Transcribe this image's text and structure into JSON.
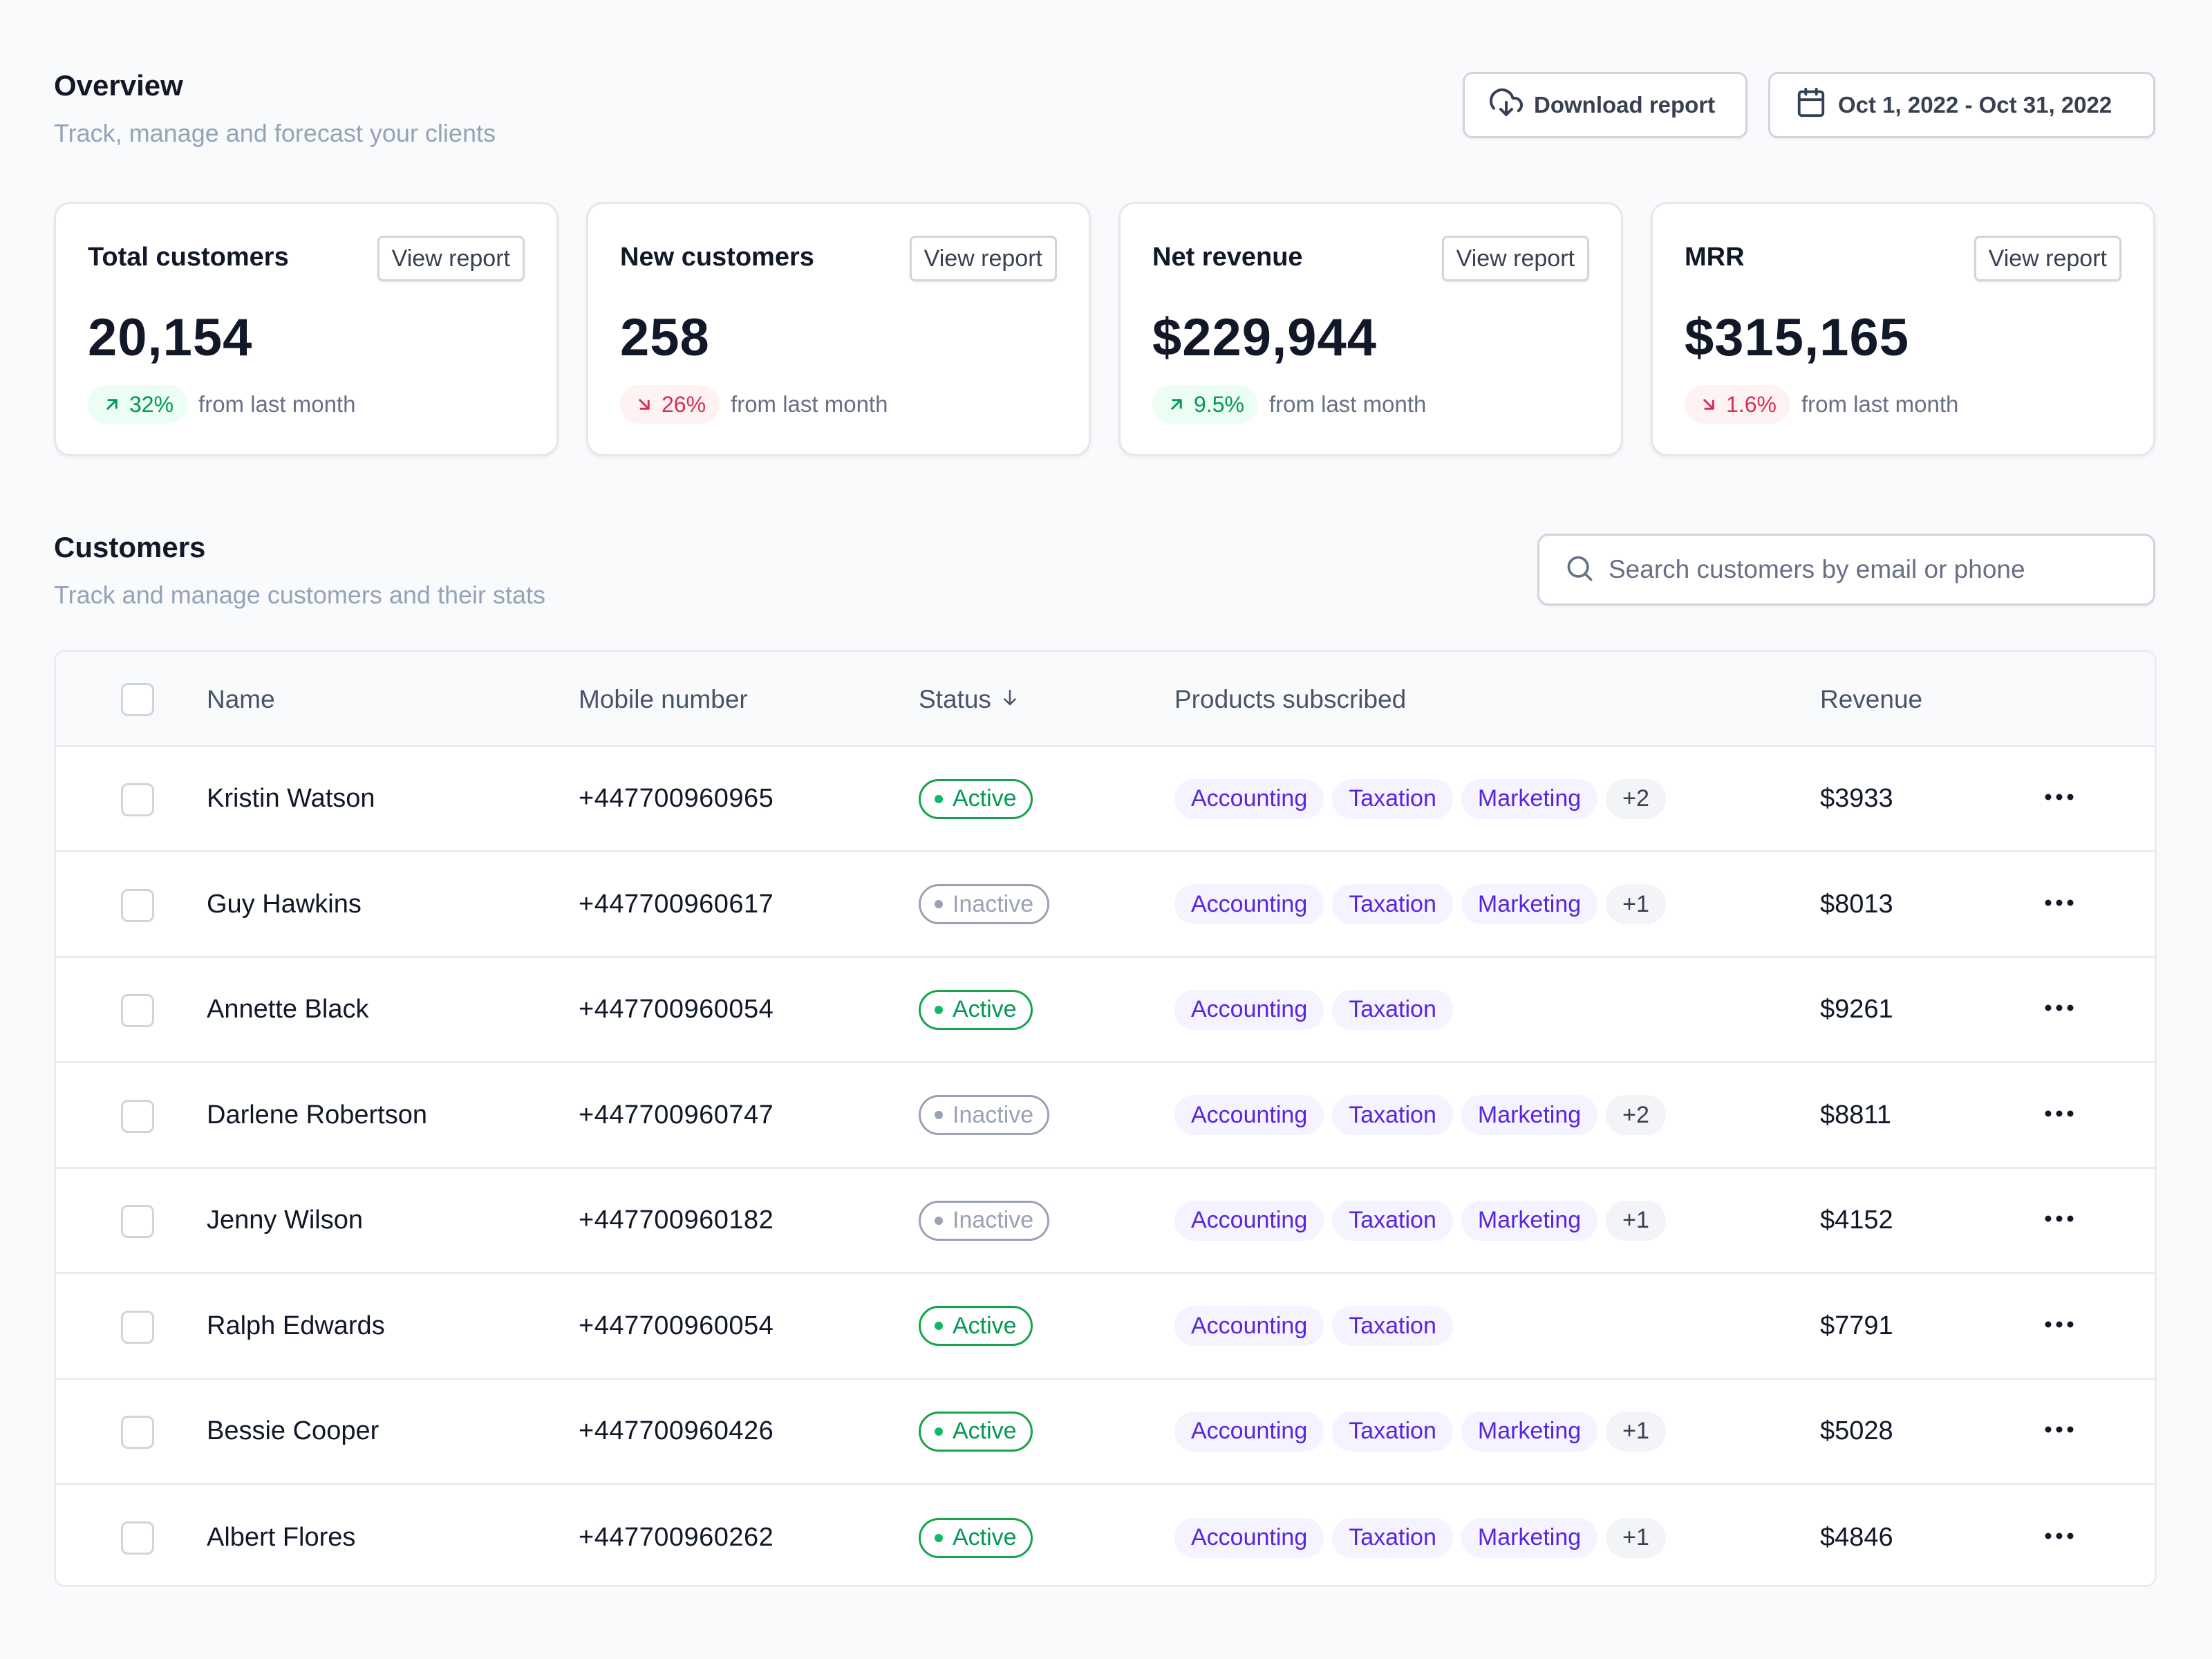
{
  "overview": {
    "title": "Overview",
    "subtitle": "Track, manage and forecast your clients",
    "download_label": "Download report",
    "date_range": "Oct 1, 2022 - Oct 31, 2022"
  },
  "colors": {
    "background": "#f8fafc",
    "positive": "#039855",
    "negative": "#d92d54",
    "chip_text": "#5925dc",
    "chip_bg": "#f4f3ff",
    "active": "#12b76a",
    "inactive": "#98a2b3"
  },
  "stats": [
    {
      "title": "Total customers",
      "button": "View report",
      "value": "20,154",
      "trend": "up",
      "trend_icon": "arrow-up-right-icon",
      "change": "32%",
      "change_label": "from last month"
    },
    {
      "title": "New customers",
      "button": "View report",
      "value": "258",
      "trend": "down",
      "trend_icon": "arrow-down-right-icon",
      "change": "26%",
      "change_label": "from last month"
    },
    {
      "title": "Net revenue",
      "button": "View report",
      "value": "$229,944",
      "trend": "up",
      "trend_icon": "arrow-up-right-icon",
      "change": "9.5%",
      "change_label": "from last month"
    },
    {
      "title": "MRR",
      "button": "View report",
      "value": "$315,165",
      "trend": "down",
      "trend_icon": "arrow-down-right-icon",
      "change": "1.6%",
      "change_label": "from last month"
    }
  ],
  "customers": {
    "title": "Customers",
    "subtitle": "Track and manage customers and their stats",
    "search": {
      "placeholder": "Search customers by email or phone",
      "value": ""
    },
    "columns": {
      "name": "Name",
      "mobile": "Mobile number",
      "status": "Status",
      "products": "Products subscribed",
      "revenue": "Revenue"
    },
    "rows": [
      {
        "name": "Kristin Watson",
        "mobile": "+447700960965",
        "status": "Active",
        "products": [
          "Accounting",
          "Taxation",
          "Marketing"
        ],
        "more": "+2",
        "revenue": "$3933"
      },
      {
        "name": "Guy Hawkins",
        "mobile": "+447700960617",
        "status": "Inactive",
        "products": [
          "Accounting",
          "Taxation",
          "Marketing"
        ],
        "more": "+1",
        "revenue": "$8013"
      },
      {
        "name": "Annette Black",
        "mobile": "+447700960054",
        "status": "Active",
        "products": [
          "Accounting",
          "Taxation"
        ],
        "more": "",
        "revenue": "$9261"
      },
      {
        "name": "Darlene Robertson",
        "mobile": "+447700960747",
        "status": "Inactive",
        "products": [
          "Accounting",
          "Taxation",
          "Marketing"
        ],
        "more": "+2",
        "revenue": "$8811"
      },
      {
        "name": "Jenny Wilson",
        "mobile": "+447700960182",
        "status": "Inactive",
        "products": [
          "Accounting",
          "Taxation",
          "Marketing"
        ],
        "more": "+1",
        "revenue": "$4152"
      },
      {
        "name": "Ralph Edwards",
        "mobile": "+447700960054",
        "status": "Active",
        "products": [
          "Accounting",
          "Taxation"
        ],
        "more": "",
        "revenue": "$7791"
      },
      {
        "name": "Bessie Cooper",
        "mobile": "+447700960426",
        "status": "Active",
        "products": [
          "Accounting",
          "Taxation",
          "Marketing"
        ],
        "more": "+1",
        "revenue": "$5028"
      },
      {
        "name": "Albert Flores",
        "mobile": "+447700960262",
        "status": "Active",
        "products": [
          "Accounting",
          "Taxation",
          "Marketing"
        ],
        "more": "+1",
        "revenue": "$4846"
      }
    ]
  }
}
